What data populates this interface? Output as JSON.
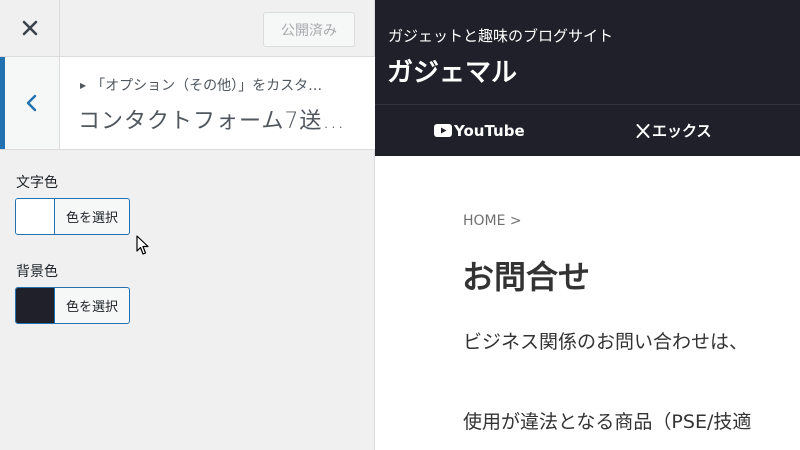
{
  "topbar": {
    "publish_label": "公開済み"
  },
  "section": {
    "breadcrumb": "「オプション（その他）」をカスタ…",
    "title": "コンタクトフォーム7送…"
  },
  "controls": [
    {
      "label": "文字色",
      "button_label": "色を選択",
      "color": "#ffffff"
    },
    {
      "label": "背景色",
      "button_label": "色を選択",
      "color": "#1f2029"
    }
  ],
  "site": {
    "tagline": "ガジェットと趣味のブログサイト",
    "name": "ガジェマル",
    "nav": [
      {
        "label": "YouTube",
        "icon": "youtube-icon"
      },
      {
        "label": "エックス",
        "icon": "x-logo-icon"
      }
    ]
  },
  "page": {
    "breadcrumb": "HOME >",
    "title": "お問合せ",
    "paragraphs": [
      "ビジネス関係のお問い合わせは、",
      "使用が違法となる商品（PSE/技適"
    ]
  },
  "colors": {
    "accent": "#2271b1",
    "header_bg": "#1f2029",
    "panel_bg": "#f0f0f1"
  }
}
